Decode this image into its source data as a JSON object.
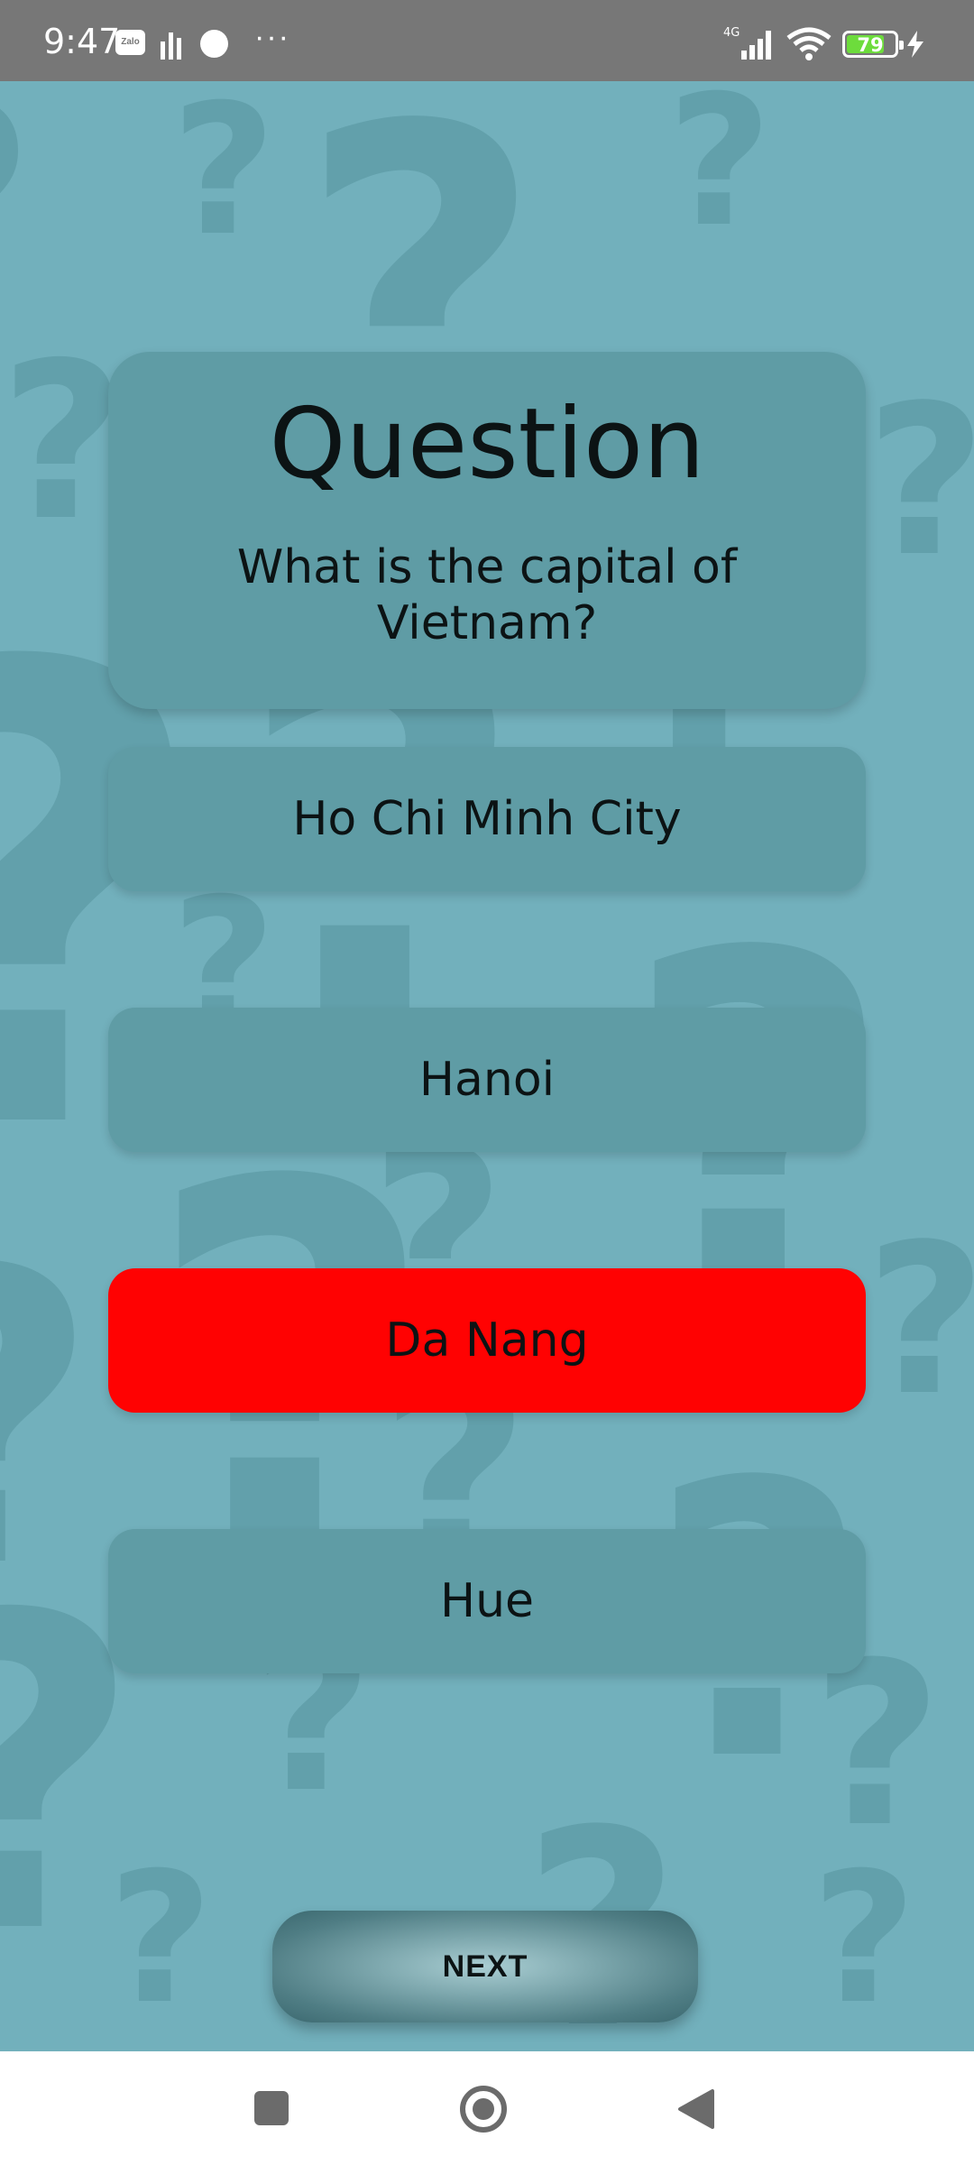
{
  "status_bar": {
    "time": "9:47",
    "zalo_label": "Zalo",
    "network": "4G",
    "battery_percent": "79",
    "battery_level": 0.79,
    "more": "···"
  },
  "question": {
    "title": "Question",
    "text": "What is the capital of Vietnam?"
  },
  "answers": [
    {
      "label": "Ho Chi Minh City",
      "state": "default"
    },
    {
      "label": "Hanoi",
      "state": "default"
    },
    {
      "label": "Da Nang",
      "state": "selected-wrong"
    },
    {
      "label": "Hue",
      "state": "default"
    }
  ],
  "next_button": {
    "label": "NEXT"
  },
  "colors": {
    "background": "#72b0bc",
    "card": "#5f9ca5",
    "wrong": "#ff0202",
    "status_bar": "#777777"
  },
  "icons": {
    "status": [
      "zalo-icon",
      "bars-icon",
      "dot-icon",
      "more-icon",
      "signal-icon",
      "wifi-icon",
      "battery-icon",
      "charge-icon"
    ],
    "nav": [
      "recents-icon",
      "home-icon",
      "back-icon"
    ]
  }
}
